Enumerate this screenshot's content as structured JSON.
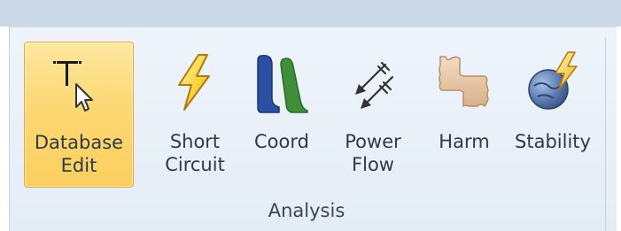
{
  "ribbon": {
    "group_label": "Analysis",
    "buttons": [
      {
        "id": "database-edit",
        "label": "Database\nEdit",
        "icon": "database-edit-cursor-icon",
        "active": true
      },
      {
        "id": "short-circuit",
        "label": "Short\nCircuit",
        "icon": "lightning-bolt-icon",
        "active": false
      },
      {
        "id": "coord",
        "label": "Coord",
        "icon": "coordination-curves-icon",
        "active": false
      },
      {
        "id": "power-flow",
        "label": "Power\nFlow",
        "icon": "power-flow-arrows-icon",
        "active": false
      },
      {
        "id": "harm",
        "label": "Harm",
        "icon": "harmonics-wave-icon",
        "active": false
      },
      {
        "id": "stability",
        "label": "Stability",
        "icon": "stability-globe-bolt-icon",
        "active": false
      }
    ]
  },
  "colors": {
    "active_fill": "#fcd873",
    "active_border": "#e3a93a",
    "ribbon_bg": "#e9f0f8",
    "top_band": "#ccd9e9",
    "text": "#2c3a4a"
  }
}
